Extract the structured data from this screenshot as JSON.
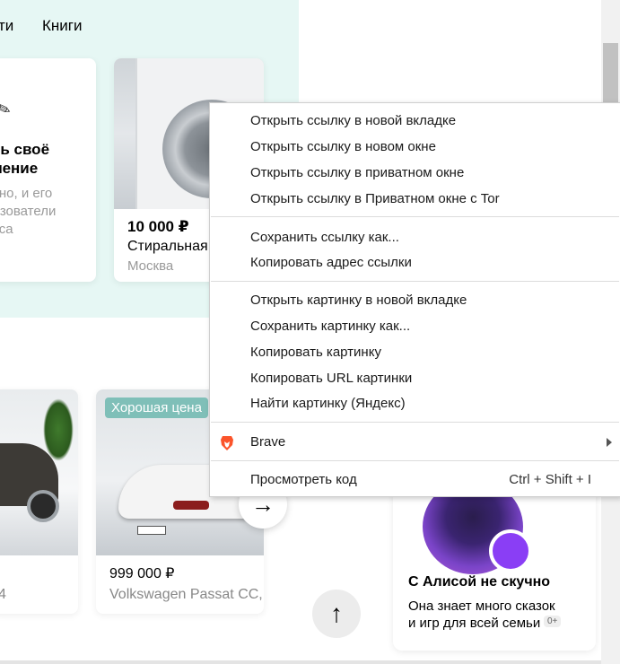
{
  "nav": {
    "partial": "ти",
    "books": "Книги"
  },
  "promo": {
    "title": "ть своё\nление",
    "text": "тно, и его\nьзователи\nкса"
  },
  "washer": {
    "price": "10 000 ₽",
    "name": "Стиральная",
    "city": "Москва"
  },
  "car1": {
    "partial_text": "4"
  },
  "car2": {
    "badge": "Хорошая цена",
    "price": "999 000 ₽",
    "name": "Volkswagen Passat CC,"
  },
  "alice": {
    "title": "С Алисой не скучно",
    "text": "Она знает много сказок\nи игр для всей семьи",
    "age": "0+"
  },
  "context_menu": {
    "items": [
      "Открыть ссылку в новой вкладке",
      "Открыть ссылку в новом окне",
      "Открыть ссылку в приватном окне",
      "Открыть ссылку в Приватном окне с Tor",
      "Сохранить ссылку как...",
      "Копировать адрес ссылки",
      "Открыть картинку в новой вкладке",
      "Сохранить картинку как...",
      "Копировать картинку",
      "Копировать URL картинки",
      "Найти картинку (Яндекс)",
      "Brave",
      "Просмотреть код"
    ],
    "inspect_shortcut": "Ctrl + Shift + I",
    "icons": {
      "brave": "brave-lion-icon",
      "submenu": "chevron-right-icon"
    }
  },
  "colors": {
    "mint": "#e6f7f4",
    "badge": "#7fbfb8",
    "brave": "#fb542b",
    "alice": "#8a3ef5"
  }
}
